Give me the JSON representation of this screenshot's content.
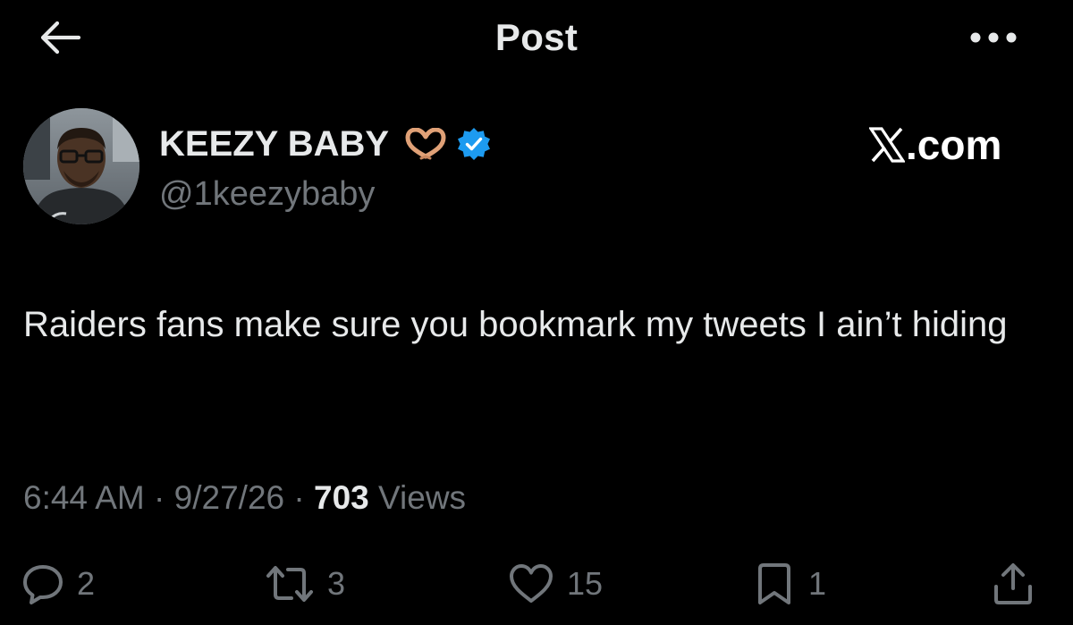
{
  "header": {
    "title": "Post",
    "back_icon": "arrow-left-icon",
    "more_icon": "more-horizontal-icon"
  },
  "post": {
    "display_name": "KEEZY BABY",
    "name_emoji": "heart-hands-emoji",
    "verified_icon": "verified-badge-icon",
    "handle": "@1keezybaby",
    "text": "Raiders fans make sure you bookmark my tweets I ain’t hiding",
    "time": "6:44 AM",
    "date": "9/27/26",
    "separator": "·",
    "views_count": "703",
    "views_label": "Views"
  },
  "watermark": {
    "text": ".com",
    "logo_icon": "x-logo-icon"
  },
  "actions": {
    "replies": "2",
    "reposts": "3",
    "likes": "15",
    "bookmarks": "1",
    "share_icon": "share-icon"
  },
  "colors": {
    "background": "#000000",
    "primary_text": "#e7e9ea",
    "secondary_text": "#71767b",
    "verified_blue": "#1d9bf0"
  }
}
